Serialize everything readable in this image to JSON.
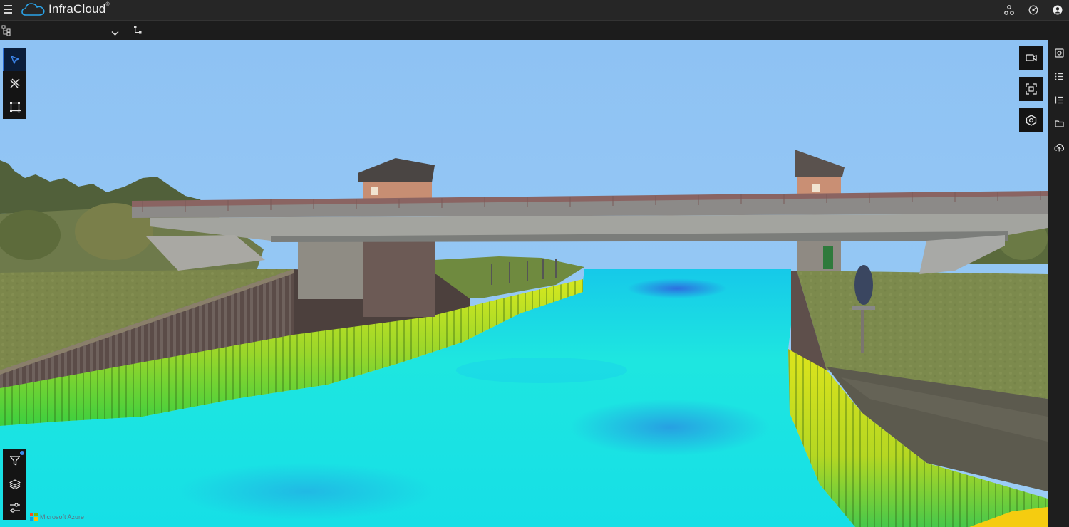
{
  "app": {
    "brand": "InfraCloud",
    "registered": "®"
  },
  "icons": {
    "menu": "hamburger-icon",
    "brand_logo": "cloud-icon",
    "network": "network-icon",
    "dashboard": "dashboard-icon",
    "account": "user-icon",
    "model_tree": "model-tree-icon",
    "dropdown": "chevron-down-icon",
    "hierarchy": "hierarchy-icon",
    "select": "cursor-icon",
    "measure": "measure-tools-icon",
    "area": "area-select-icon",
    "filter": "filter-icon",
    "layers": "layers-icon",
    "settings": "sliders-icon",
    "camera": "video-camera-icon",
    "focus": "focus-frame-icon",
    "object": "hexagon-object-icon",
    "viewer": "viewer-icon",
    "list": "list-icon",
    "list_alt": "ordered-list-icon",
    "folder": "folder-icon",
    "upload": "cloud-upload-icon"
  },
  "colors": {
    "accent": "#2d6fd6",
    "topbar": "#262626",
    "sky": "#8fc3f2",
    "water": "#1ee3e3",
    "wall_high": "#c8e61e"
  },
  "footer": {
    "azure_label": "Microsoft Azure"
  },
  "toolbar": {
    "selected_model": ""
  }
}
